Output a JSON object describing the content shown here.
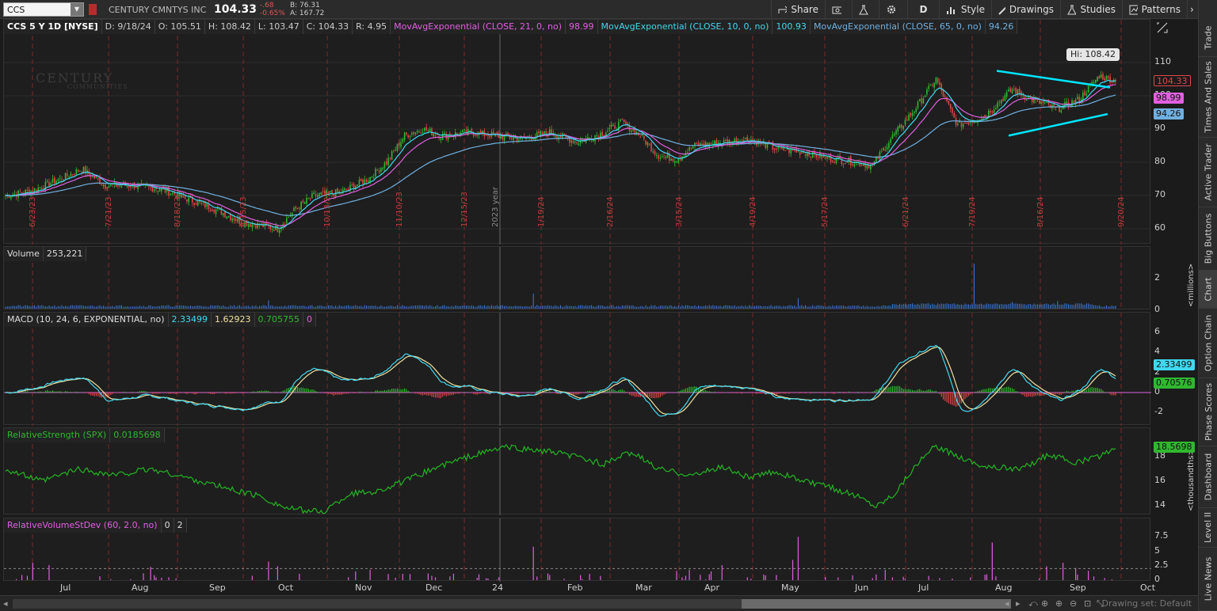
{
  "toolbar": {
    "symbol": "CCS",
    "company": "CENTURY CMNTYS INC",
    "last": "104.33",
    "change": "-.68",
    "change_pct": "-0.65%",
    "bid": "B: 76.31",
    "ask": "A: 167.72",
    "buttons": {
      "share": "Share",
      "period": "D",
      "style": "Style",
      "drawings": "Drawings",
      "studies": "Studies",
      "patterns": "Patterns"
    }
  },
  "right_tabs": [
    "Trade",
    "Times And Sales",
    "Active Trader",
    "Big Buttons",
    "Chart",
    "Option Chain",
    "Phase Scores",
    "Dashboard",
    "Level II",
    "Live News"
  ],
  "price_panel": {
    "title": "CCS 5 Y 1D [NYSE]",
    "date": "D: 9/18/24",
    "open": "O: 105.51",
    "high": "H: 108.42",
    "low": "L: 103.47",
    "close": "C: 104.33",
    "range": "R: 4.95",
    "ema21_label": "MovAvgExponential (CLOSE, 21, 0, no)",
    "ema21_value": "98.99",
    "ema10_label": "MovAvgExponential (CLOSE, 10, 0, no)",
    "ema10_value": "100.93",
    "ema65_label": "MovAvgExponential (CLOSE, 65, 0, no)",
    "ema65_value": "94.26",
    "hi_callout": "Hi: 108.42",
    "watermark_line1": "CENTURY",
    "watermark_line2": "COMMUNITIES",
    "year_label": "2023 year",
    "axis": [
      "110",
      "100",
      "90",
      "80",
      "70",
      "60"
    ],
    "tags": {
      "last": "104.33",
      "ema21": "98.99",
      "ema65": "94.26"
    },
    "period_dates": [
      "6/23/23",
      "7/21/23",
      "8/18/23",
      "9/15/23",
      "10/13/23",
      "11/10/23",
      "12/15/23",
      "1/19/24",
      "2/16/24",
      "3/15/24",
      "4/19/24",
      "5/17/24",
      "6/21/24",
      "7/19/24",
      "8/16/24",
      "9/20/24"
    ]
  },
  "volume_panel": {
    "title": "Volume",
    "value": "253,221",
    "axis": [
      "2",
      "0"
    ],
    "unit": "<millions>"
  },
  "macd_panel": {
    "title": "MACD (10, 24, 6, EXPONENTIAL, no)",
    "value": "2.33499",
    "avg": "1.62923",
    "diff": "0.705755",
    "zero": "0",
    "axis": [
      "6",
      "4",
      "2",
      "0",
      "-2"
    ],
    "tags": {
      "value": "2.33499",
      "diff": "0.70576"
    }
  },
  "rs_panel": {
    "title": "RelativeStrength (SPX)",
    "value": "0.0185698",
    "axis": [
      "18",
      "16",
      "14"
    ],
    "tag": "18.5698",
    "unit": "<thousandths>"
  },
  "rvs_panel": {
    "title": "RelativeVolumeStDev (60, 2.0, no)",
    "v1": "0",
    "v2": "2",
    "axis": [
      "7.5",
      "5",
      "2.5",
      "0"
    ]
  },
  "x_axis": [
    "Jul",
    "Aug",
    "Sep",
    "Oct",
    "Nov",
    "Dec",
    "24",
    "Feb",
    "Mar",
    "Apr",
    "May",
    "Jun",
    "Jul",
    "Aug",
    "Sep",
    "Oct"
  ],
  "bottom": {
    "drawing_set": "Drawing set: Default"
  },
  "colors": {
    "up": "#2fb82f",
    "down": "#e04747",
    "ema21": "#e060e0",
    "ema10": "#40d8f0",
    "ema65": "#70b0e0",
    "trend": "#00e5ff",
    "rs": "#23b523"
  }
}
